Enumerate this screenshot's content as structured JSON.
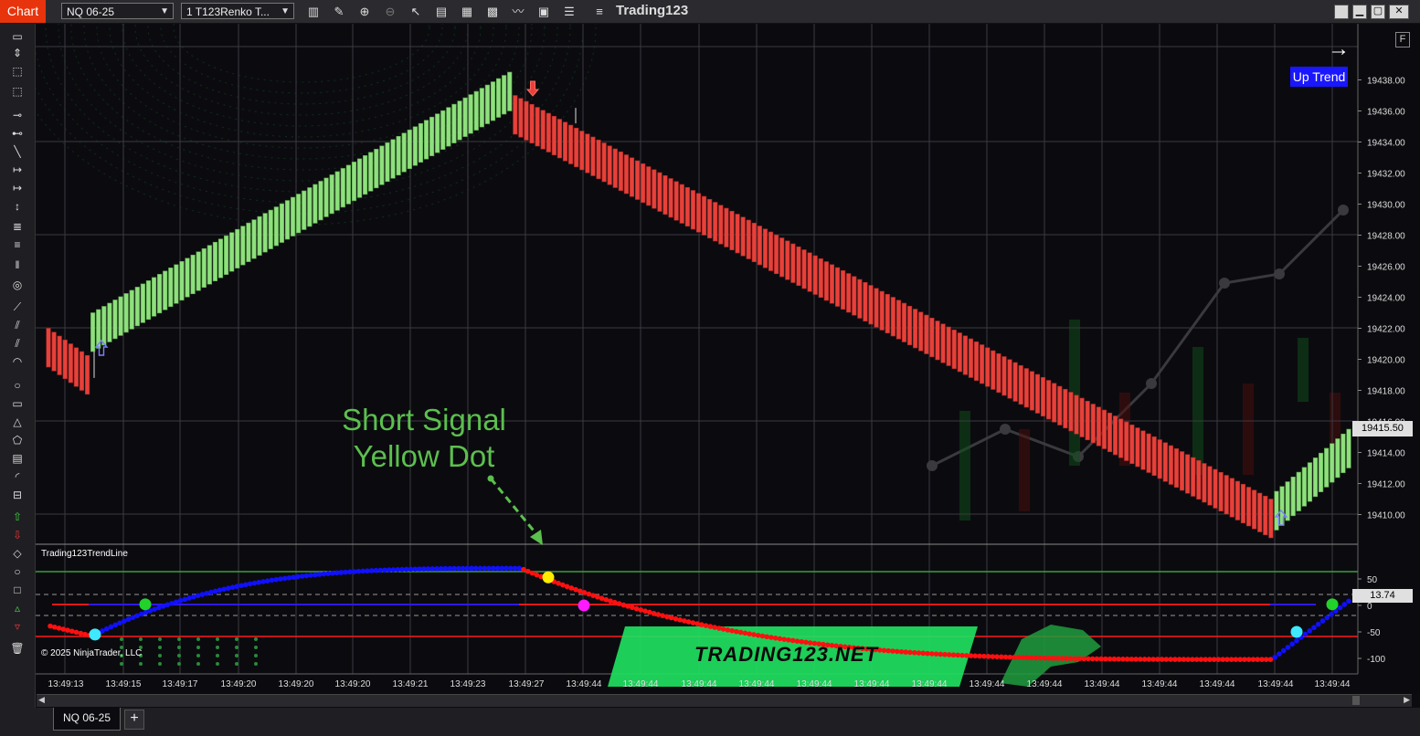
{
  "titlebar": {
    "window_label": "Chart",
    "instrument": "NQ 06-25",
    "bar_type": "1 T123Renko T...",
    "app_name": "Trading123"
  },
  "chart": {
    "right_arrow": "→",
    "f_button": "F",
    "trend_label": "Up Trend",
    "price_ticks": [
      "19438.00",
      "19436.00",
      "19434.00",
      "19432.00",
      "19430.00",
      "19428.00",
      "19426.00",
      "19424.00",
      "19422.00",
      "19420.00",
      "19418.00",
      "19416.00",
      "19414.00",
      "19412.00",
      "19410.00"
    ],
    "current_price": "19415.50",
    "annotation_line1": "Short Signal",
    "annotation_line2": "Yellow Dot",
    "indicator_name": "Trading123TrendLine",
    "indicator_ticks": [
      "50",
      "0",
      "-50",
      "-100"
    ],
    "indicator_value": "13.74",
    "copyright": "© 2025 NinjaTrader, LLC",
    "watermark": "TRADING123.NET",
    "time_labels": [
      "13:49:13",
      "13:49:15",
      "13:49:17",
      "13:49:20",
      "13:49:20",
      "13:49:20",
      "13:49:21",
      "13:49:23",
      "13:49:27",
      "13:49:44",
      "13:49:44",
      "13:49:44",
      "13:49:44",
      "13:49:44",
      "13:49:44",
      "13:49:44",
      "13:49:44",
      "13:49:44",
      "13:49:44",
      "13:49:44",
      "13:49:44",
      "13:49:44",
      "13:49:44",
      "13:49:44"
    ],
    "colors": {
      "up": "#8ee07d",
      "down": "#e8403a",
      "trend_blue": "#1010ff",
      "trend_red": "#ff1010",
      "annotation": "#5cbf4e",
      "badge": "#1a17ff"
    }
  },
  "bottom": {
    "tab_label": "NQ 06-25",
    "add_tab": "+"
  }
}
